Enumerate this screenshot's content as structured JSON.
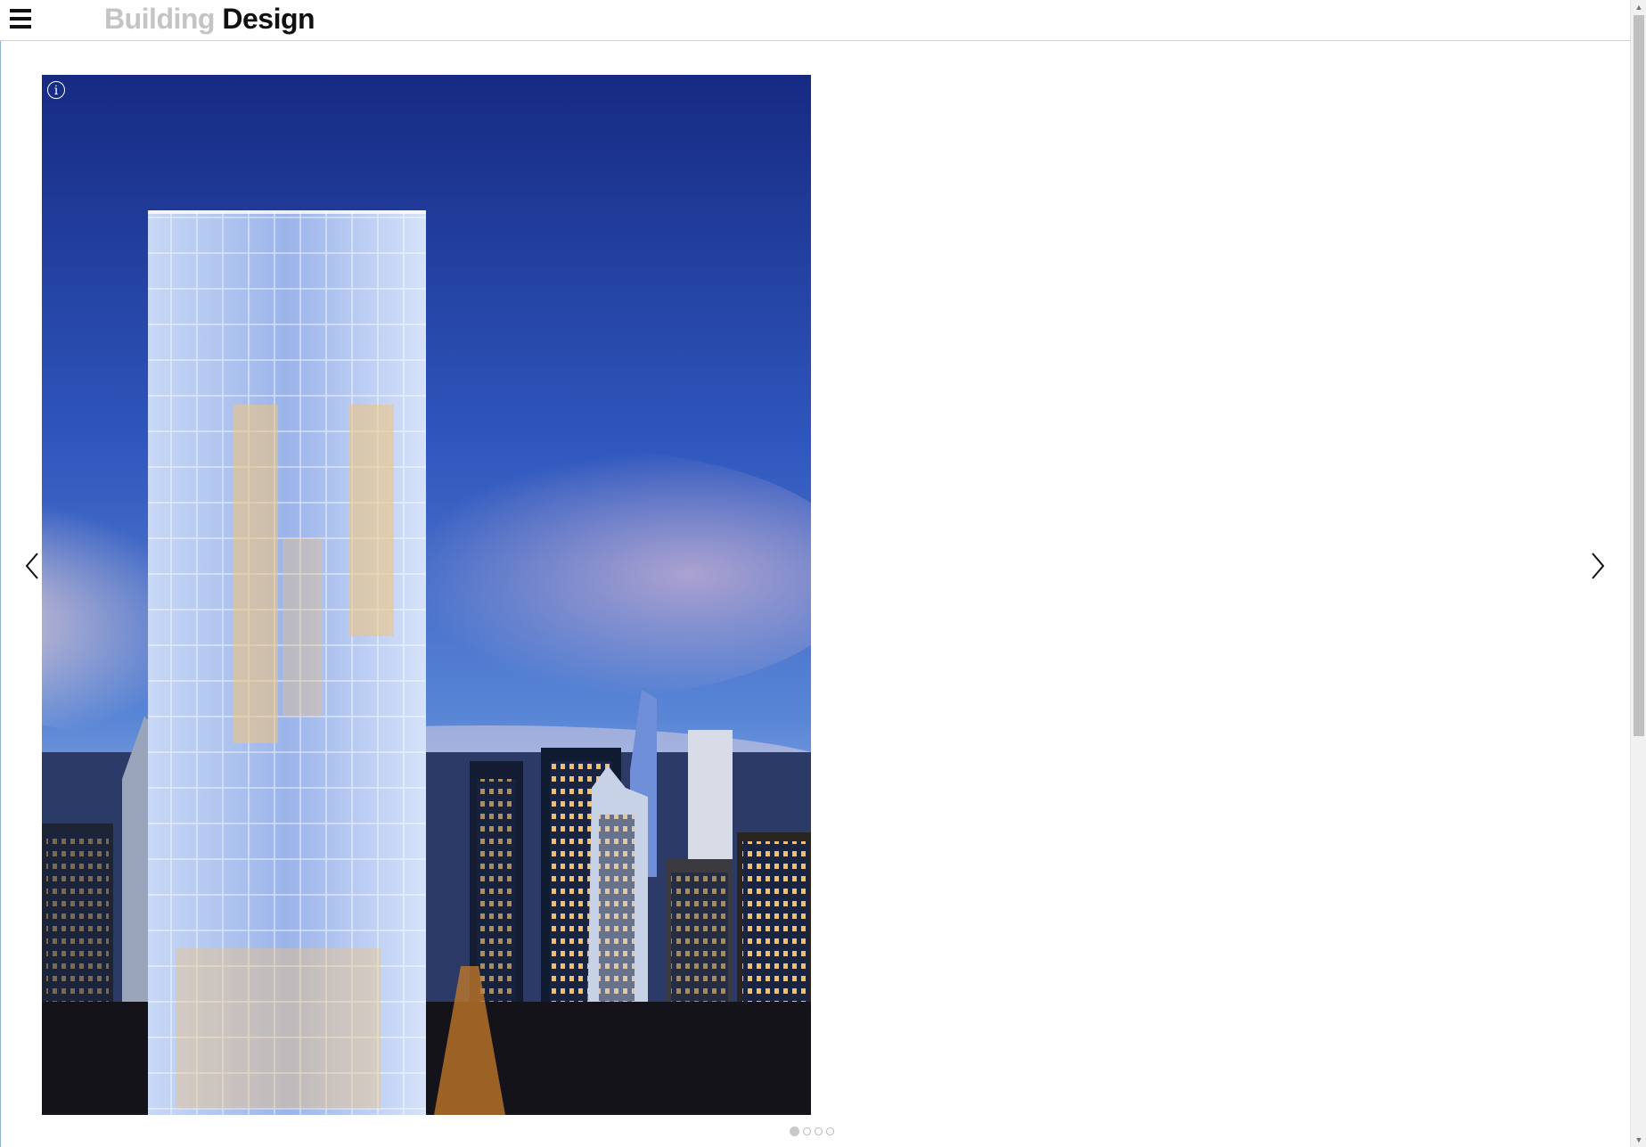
{
  "header": {
    "menu_icon": "hamburger-icon",
    "brand": {
      "part1": "Building",
      "part2": "Design"
    }
  },
  "slideshow": {
    "image_subject": "Glass residential tower above a city skyline at dusk",
    "info_symbol": "i",
    "prev_icon": "chevron-left-icon",
    "next_icon": "chevron-right-icon",
    "total_slides": 4,
    "active_slide": 1
  },
  "colors": {
    "brand_muted": "#c4c4c4",
    "brand_dark": "#111111",
    "sky_top": "#1b2f8a",
    "sky_mid": "#3b63c6",
    "window_light": "#f6c46a"
  }
}
